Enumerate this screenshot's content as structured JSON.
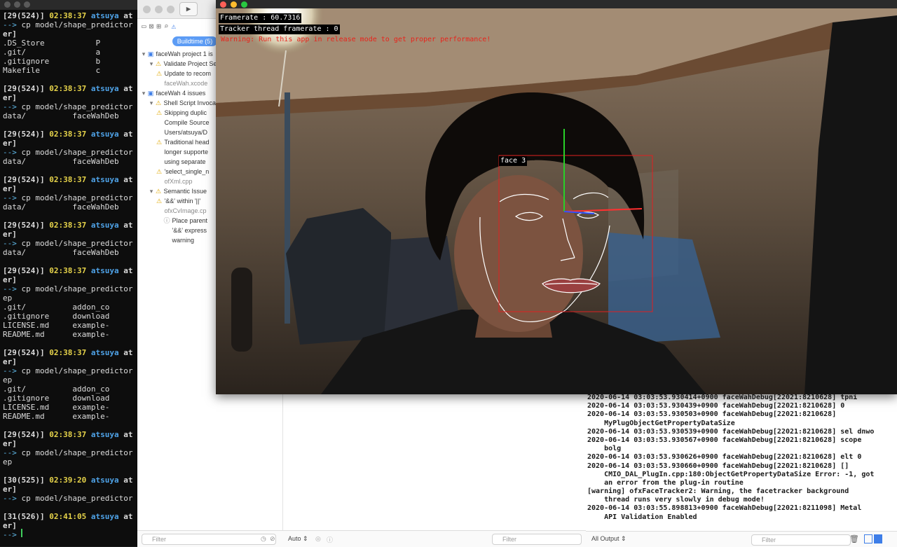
{
  "terminal": {
    "lines": [
      {
        "t": "plain",
        "text": "[29(524)] ",
        "time": "02:38:37",
        "user": "atsuya",
        "rest": " at"
      },
      {
        "t": "cmd",
        "text": "cp model/shape_predictor"
      },
      {
        "t": "bold",
        "text": "er]"
      },
      {
        "t": "plain2",
        "text": ".DS_Store           P"
      },
      {
        "t": "plain2",
        "text": ".git/               a"
      },
      {
        "t": "plain2",
        "text": ".gitignore          b"
      },
      {
        "t": "plain2",
        "text": "Makefile            c"
      },
      {
        "t": "blank",
        "text": ""
      },
      {
        "t": "prompt",
        "text": "[29(524)] ",
        "time": "02:38:37",
        "user": "atsuya",
        "rest": " at"
      },
      {
        "t": "bold",
        "text": "er]"
      },
      {
        "t": "cmd",
        "text": "cp model/shape_predictor"
      },
      {
        "t": "plain2",
        "text": "data/          faceWahDeb"
      },
      {
        "t": "blank",
        "text": ""
      },
      {
        "t": "prompt",
        "text": "[29(524)] ",
        "time": "02:38:37",
        "user": "atsuya",
        "rest": " at"
      },
      {
        "t": "bold",
        "text": "er]"
      },
      {
        "t": "cmd",
        "text": "cp model/shape_predictor"
      },
      {
        "t": "plain2",
        "text": "data/          faceWahDeb"
      },
      {
        "t": "blank",
        "text": ""
      },
      {
        "t": "prompt",
        "text": "[29(524)] ",
        "time": "02:38:37",
        "user": "atsuya",
        "rest": " at"
      },
      {
        "t": "bold",
        "text": "er]"
      },
      {
        "t": "cmd",
        "text": "cp model/shape_predictor"
      },
      {
        "t": "plain2",
        "text": "data/          faceWahDeb"
      },
      {
        "t": "blank",
        "text": ""
      },
      {
        "t": "prompt",
        "text": "[29(524)] ",
        "time": "02:38:37",
        "user": "atsuya",
        "rest": " at"
      },
      {
        "t": "bold",
        "text": "er]"
      },
      {
        "t": "cmd",
        "text": "cp model/shape_predictor"
      },
      {
        "t": "plain2",
        "text": "data/          faceWahDeb"
      },
      {
        "t": "blank",
        "text": ""
      },
      {
        "t": "prompt",
        "text": "[29(524)] ",
        "time": "02:38:37",
        "user": "atsuya",
        "rest": " at"
      },
      {
        "t": "bold",
        "text": "er]"
      },
      {
        "t": "cmd",
        "text": "cp model/shape_predictor"
      },
      {
        "t": "plain2",
        "text": "ep"
      },
      {
        "t": "plain2",
        "text": ".git/          addon_co"
      },
      {
        "t": "plain2",
        "text": ".gitignore     download"
      },
      {
        "t": "plain2",
        "text": "LICENSE.md     example-"
      },
      {
        "t": "plain2",
        "text": "README.md      example-"
      },
      {
        "t": "blank",
        "text": ""
      },
      {
        "t": "prompt",
        "text": "[29(524)] ",
        "time": "02:38:37",
        "user": "atsuya",
        "rest": " at"
      },
      {
        "t": "bold",
        "text": "er]"
      },
      {
        "t": "cmd",
        "text": "cp model/shape_predictor"
      },
      {
        "t": "plain2",
        "text": "ep"
      },
      {
        "t": "plain2",
        "text": ".git/          addon_co"
      },
      {
        "t": "plain2",
        "text": ".gitignore     download"
      },
      {
        "t": "plain2",
        "text": "LICENSE.md     example-"
      },
      {
        "t": "plain2",
        "text": "README.md      example-"
      },
      {
        "t": "blank",
        "text": ""
      },
      {
        "t": "prompt",
        "text": "[29(524)] ",
        "time": "02:38:37",
        "user": "atsuya",
        "rest": " at"
      },
      {
        "t": "bold",
        "text": "er]"
      },
      {
        "t": "cmd",
        "text": "cp model/shape_predictor"
      },
      {
        "t": "plain2",
        "text": "ep"
      },
      {
        "t": "blank",
        "text": ""
      },
      {
        "t": "prompt",
        "text": "[30(525)] ",
        "time": "02:39:20",
        "user": "atsuya",
        "rest": " at"
      },
      {
        "t": "bold",
        "text": "er]"
      },
      {
        "t": "cmd",
        "text": "cp model/shape_predictor"
      },
      {
        "t": "blank",
        "text": ""
      },
      {
        "t": "prompt",
        "text": "[31(526)] ",
        "time": "02:41:05",
        "user": "atsuya",
        "rest": " at"
      },
      {
        "t": "bold",
        "text": "er]"
      },
      {
        "t": "cmd",
        "text": ""
      }
    ],
    "arrow": "-->"
  },
  "xcode": {
    "build_tab": "Buildtime (5)",
    "issues": [
      {
        "depth": 0,
        "icon": "project",
        "text": "faceWah project 1 is",
        "cls": ""
      },
      {
        "depth": 1,
        "icon": "warn",
        "text": "Validate Project Se",
        "cls": ""
      },
      {
        "depth": 2,
        "icon": "warn",
        "text": "Update to recom",
        "cls": ""
      },
      {
        "depth": 2,
        "icon": "none",
        "text": "faceWah.xcode",
        "cls": "sub"
      },
      {
        "depth": 0,
        "icon": "project",
        "text": "faceWah 4 issues",
        "cls": ""
      },
      {
        "depth": 1,
        "icon": "warn",
        "text": "Shell Script Invoca",
        "cls": ""
      },
      {
        "depth": 2,
        "icon": "warn",
        "text": "Skipping duplic",
        "cls": ""
      },
      {
        "depth": 2,
        "icon": "none",
        "text": "Compile Source",
        "cls": ""
      },
      {
        "depth": 2,
        "icon": "none",
        "text": "Users/atsuya/D",
        "cls": ""
      },
      {
        "depth": 2,
        "icon": "warn",
        "text": "Traditional head",
        "cls": ""
      },
      {
        "depth": 2,
        "icon": "none",
        "text": "longer supporte",
        "cls": ""
      },
      {
        "depth": 2,
        "icon": "none",
        "text": "using separate",
        "cls": ""
      },
      {
        "depth": 2,
        "icon": "warn",
        "text": "'select_single_n",
        "cls": ""
      },
      {
        "depth": 2,
        "icon": "none",
        "text": "ofXml.cpp",
        "cls": "sub"
      },
      {
        "depth": 1,
        "icon": "warn",
        "text": "Semantic Issue",
        "cls": ""
      },
      {
        "depth": 2,
        "icon": "warn",
        "text": "'&&' within '||'",
        "cls": ""
      },
      {
        "depth": 2,
        "icon": "none",
        "text": "ofxCvImage.cp",
        "cls": "sub"
      },
      {
        "depth": 3,
        "icon": "info",
        "text": "Place parent",
        "cls": ""
      },
      {
        "depth": 3,
        "icon": "none",
        "text": "'&&' express",
        "cls": ""
      },
      {
        "depth": 3,
        "icon": "none",
        "text": "warning",
        "cls": ""
      }
    ],
    "filter_placeholder": "Filter",
    "auto_label": "Auto",
    "editor_filter_placeholder": "Filter"
  },
  "console": {
    "lines": [
      "2020-06-14 03:03:53.930414+0900 faceWahDebug[22021:8210628] tpni",
      "2020-06-14 03:03:53.930439+0900 faceWahDebug[22021:8210628] 0",
      "2020-06-14 03:03:53.930503+0900 faceWahDebug[22021:8210628]",
      "    MyPlugObjectGetPropertyDataSize",
      "2020-06-14 03:03:53.930539+0900 faceWahDebug[22021:8210628] sel dnwo",
      "2020-06-14 03:03:53.930567+0900 faceWahDebug[22021:8210628] scope",
      "    bolg",
      "2020-06-14 03:03:53.930626+0900 faceWahDebug[22021:8210628] elt 0",
      "2020-06-14 03:03:53.930660+0900 faceWahDebug[22021:8210628] []",
      "    CMIO_DAL_PlugIn.cpp:180:ObjectGetPropertyDataSize Error: -1, got",
      "    an error from the plug-in routine",
      "[warning] ofxFaceTracker2: Warning, the facetracker background",
      "    thread runs very slowly in debug mode!",
      "2020-06-14 03:03:55.898813+0900 faceWahDebug[22021:8211098] Metal",
      "    API Validation Enabled"
    ],
    "output_selector": "All Output",
    "filter_placeholder": "Filter"
  },
  "app": {
    "framerate": "Framerate : 60.7316",
    "tracker_framerate": "Tracker thread framerate : 0",
    "warning": "Warning: Run this app in release mode to get proper performance!",
    "face_label": "face 3"
  },
  "colors": {
    "warning_red": "#e8241b",
    "face_box": "#e02020",
    "axis_green": "#28d028",
    "axis_red": "#ff3030",
    "axis_blue": "#3050ff",
    "landmark_white": "#ffffff"
  }
}
